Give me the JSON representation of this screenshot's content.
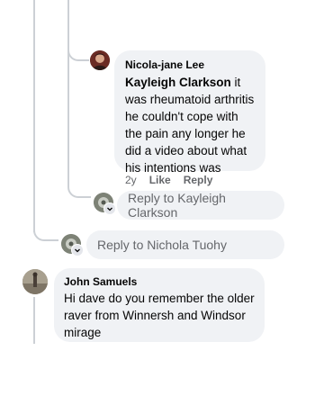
{
  "reply_comment": {
    "author": "Nicola-jane Lee",
    "mention": "Kayleigh Clarkson",
    "text_after_mention": " it was rheumatoid arthritis he couldn't cope with the pain any longer he did a video about what his intentions was",
    "age": "2y",
    "like_label": "Like",
    "reply_label": "Reply"
  },
  "reply_box_inner": {
    "placeholder": "Reply to Kayleigh Clarkson"
  },
  "reply_box_outer": {
    "placeholder": "Reply to Nichola Tuohy"
  },
  "comment": {
    "author": "John Samuels",
    "text": "Hi dave do you remember the older raver from Winnersh and Windsor mirage"
  },
  "colors": {
    "bubble_bg": "#f0f2f5",
    "thread_line": "#ccd0d5",
    "secondary_text": "#65676b"
  }
}
